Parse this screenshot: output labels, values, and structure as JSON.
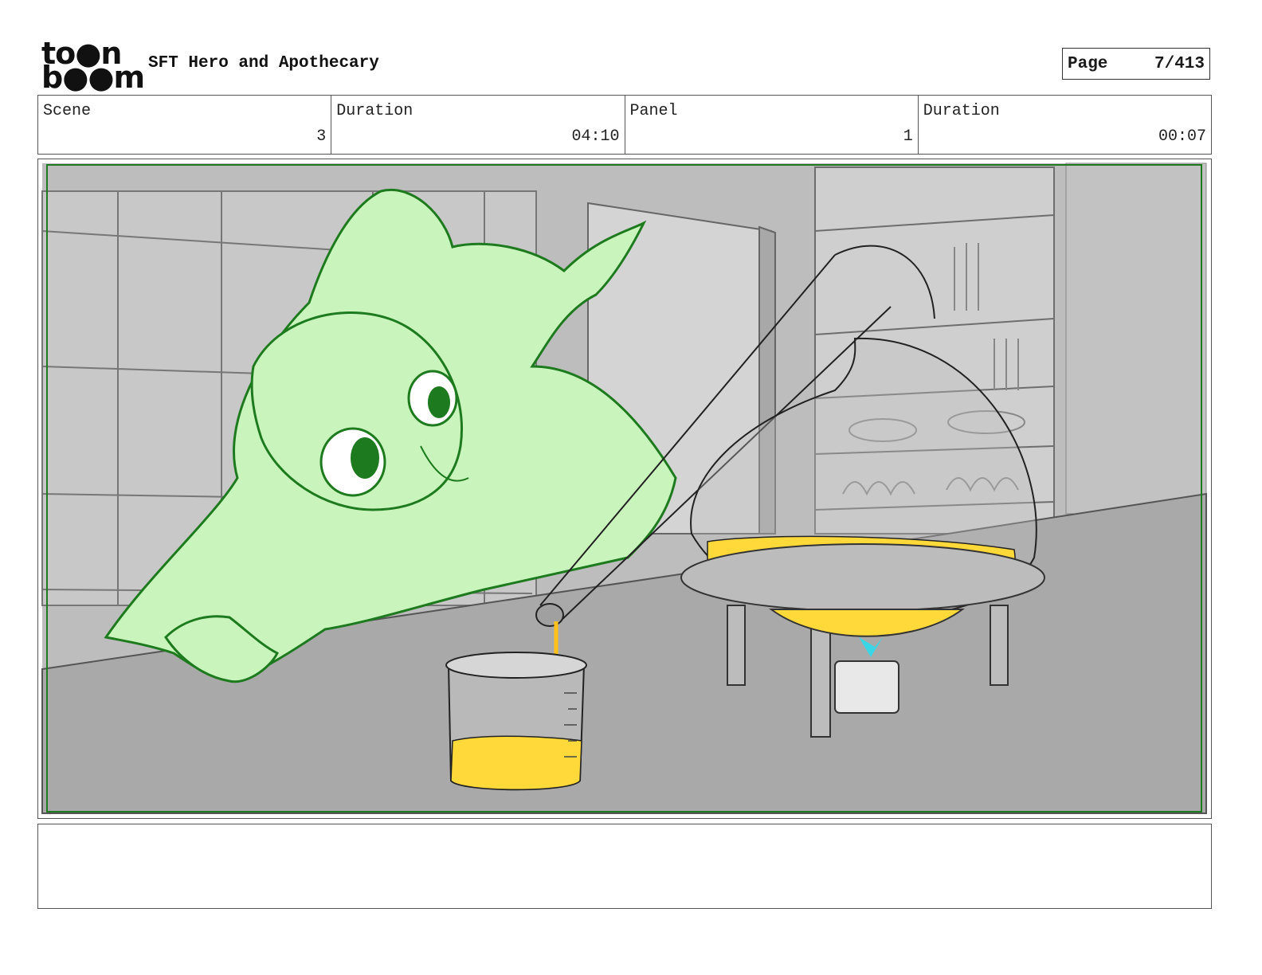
{
  "header": {
    "logo_line1": "to●n",
    "logo_line2": "b●●m",
    "title": "SFT Hero and Apothecary",
    "page_label": "Page",
    "page_value": "7/413"
  },
  "info": {
    "scene_label": "Scene",
    "scene_value": "3",
    "duration_label": "Duration",
    "duration_value": "04:10",
    "panel_label": "Panel",
    "panel_value": "1",
    "panel_duration_label": "Duration",
    "panel_duration_value": "00:07"
  },
  "caption": {
    "text": ""
  },
  "colors": {
    "safe_frame": "#1f7a1f",
    "character_fill": "#c9f5bd",
    "character_line": "#1e7a1e",
    "liquid": "#ffd93a",
    "flame": "#3ad6e6"
  }
}
